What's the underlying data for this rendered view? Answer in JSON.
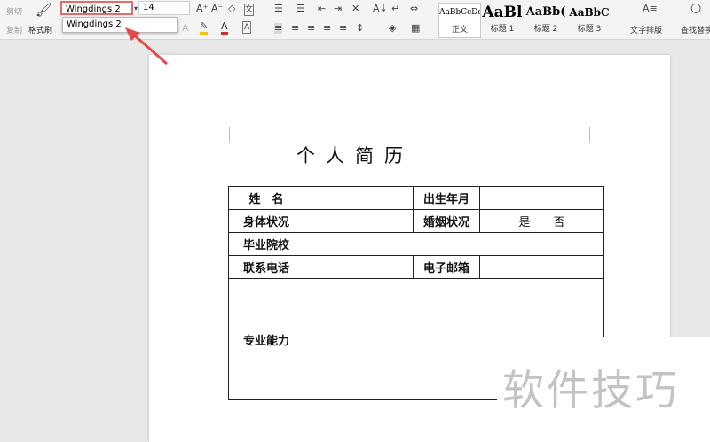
{
  "clipboard": {
    "cut_label": "剪切",
    "copy_label": "复制",
    "format_painter_label": "格式刷"
  },
  "font": {
    "name_value": "Wingdings 2",
    "dropdown_suggestion": "Wingdings 2",
    "size_value": "14"
  },
  "icons": {
    "grow_font": "A⁺",
    "shrink_font": "A⁻",
    "clear_format": "◇",
    "char_border": "文",
    "bold_like_a": "A",
    "highlight": "✎",
    "font_color": "A",
    "char_shade": "A",
    "bullets": "☰",
    "numbering": "☰",
    "indent_dec": "⇤",
    "indent_inc": "⇥",
    "chinese_layout": "✕",
    "sort": "A↓",
    "show_marks": "↵",
    "spacing": "⇔",
    "align_left": "≡",
    "align_center": "≡",
    "align_right": "≡",
    "justify": "≡",
    "distribute": "≡",
    "line_spacing": "↕",
    "shading": "◈",
    "borders": "▦",
    "text_layout": "A≡",
    "find": "○"
  },
  "styles": [
    {
      "sample": "AaBbCcDd",
      "label": "正文"
    },
    {
      "sample": "AaBl",
      "label": "标题 1"
    },
    {
      "sample": "AaBb(",
      "label": "标题 2"
    },
    {
      "sample": "AaBbC",
      "label": "标题 3"
    }
  ],
  "ribbon": {
    "text_layout_label": "文字排版",
    "find_replace_label": "查找替换"
  },
  "colors": {
    "annotation_red": "#e24b4b",
    "highlight_yellow": "#f0c419",
    "font_red": "#d12b2b"
  },
  "document": {
    "title": "个人简历",
    "rows": {
      "name_label": "姓　名",
      "birth_label": "出生年月",
      "health_label": "身体状况",
      "marital_label": "婚姻状况",
      "marital_value": "是　　否",
      "school_label": "毕业院校",
      "phone_label": "联系电话",
      "email_label": "电子邮箱",
      "skills_label": "专业能力"
    }
  },
  "watermark": "软件技巧"
}
